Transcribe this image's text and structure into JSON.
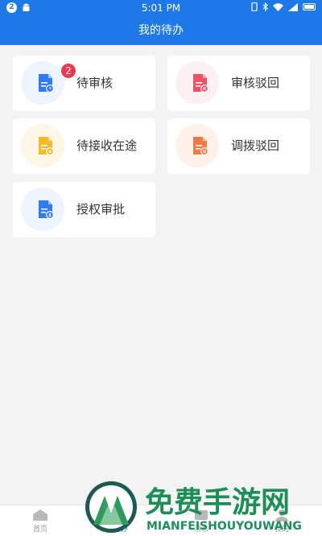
{
  "status": {
    "notification_count": "2",
    "time": "5:01 PM"
  },
  "header": {
    "title": "我的待办"
  },
  "cards": [
    {
      "label": "待审核",
      "badge": "2",
      "icon": "pending-review-doc-icon",
      "color": "#2f7cf2",
      "bg": "#eef4fd"
    },
    {
      "label": "审核驳回",
      "badge": null,
      "icon": "review-rejected-doc-icon",
      "color": "#f04f66",
      "bg": "#fdf0f3"
    },
    {
      "label": "待接收在途",
      "badge": null,
      "icon": "pending-receive-doc-icon",
      "color": "#f5b92a",
      "bg": "#fdf6e6"
    },
    {
      "label": "调拨驳回",
      "badge": null,
      "icon": "transfer-rejected-doc-icon",
      "color": "#f07a43",
      "bg": "#fdf1ea"
    },
    {
      "label": "授权审批",
      "badge": null,
      "icon": "authorization-approval-doc-icon",
      "color": "#2f7cf2",
      "bg": "#eef4fd"
    }
  ],
  "tabbar": {
    "tabs": [
      {
        "label": "首页",
        "icon": "home-icon",
        "active": false
      },
      {
        "label": "待办",
        "icon": "todo-icon",
        "active": true
      },
      {
        "label": "消息",
        "icon": "message-icon",
        "active": false
      },
      {
        "label": "我的",
        "icon": "profile-icon",
        "active": false
      }
    ]
  },
  "watermark": {
    "text": "免费手游网",
    "subtext": "MIANFEISHOUYOUWANG"
  }
}
